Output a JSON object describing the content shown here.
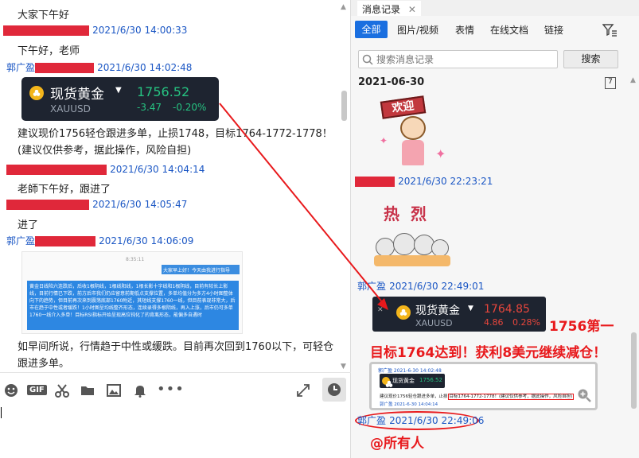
{
  "chat": {
    "messages": [
      {
        "text": "大家下午好"
      },
      {
        "time": "2021/6/30 14:00:33",
        "text": "下午好，老师"
      },
      {
        "sender": "郭广盈",
        "time": "2021/6/30 14:02:48"
      },
      {
        "text": "建议现价1756轻仓跟进多单，止损1748，目标1764-1772-1778！(建议仅供参考，据此操作，风险自担)"
      },
      {
        "time": "2021/6/30 14:04:14",
        "text": "老師下午好，跟进了"
      },
      {
        "time": "2021/6/30 14:05:47",
        "text": "进了"
      },
      {
        "sender": "郭广盈",
        "time": "2021/6/30 14:06:09"
      },
      {
        "text": "如早间所说，行情趋于中性或缓跌。目前再次回到1760以下，可轻仓跟进多单。"
      }
    ],
    "gold_card": {
      "title": "现货黄金",
      "symbol": "XAUUSD",
      "price": "1756.52",
      "change": "-3.47",
      "change_pct": "-0.20%"
    },
    "screenshot_msg": {
      "bubble": "大家早上好！今天由我进行指导",
      "time": "8:35:11",
      "body": "黄金日线险六连跌后，后收1根阴线，1根线阳线，1根长影十字线和1根阴线，目前有较长上影线，目前行情已下跌，前方后市我们仍应留意前期低点支撑位置，多单均值分为多方4小时图整体向下的趋势，但目前再次来到震荡底部1760附近，其短线支撑1760一线，但目前表现非常大，后市在趋于中性或者缓跌！1小时图呈均线整齐形态，连续录得多根阴线，再入上涨，后市仍可多单1760一线介入多单！目标RSI指标开始呈现高位钝化了的背离形态，能偏多自遇时"
    }
  },
  "toolbar": {
    "icons": [
      "emoji-icon",
      "gif-icon",
      "scissors-icon",
      "folder-icon",
      "image-icon",
      "bell-icon",
      "more-icon",
      "expand-icon",
      "history-icon"
    ],
    "gif_label": "GIF"
  },
  "history": {
    "title": "消息记录",
    "close": "✕",
    "tabs": [
      "全部",
      "图片/视频",
      "表情",
      "在线文档",
      "链接"
    ],
    "active_tab": "全部",
    "search_placeholder": "搜索消息记录",
    "search_button": "搜索",
    "date": "2021-06-30",
    "calendar_icon": "7",
    "entries": [
      {
        "time": "2021/6/30 22:23:21",
        "sticker": "欢迎"
      },
      {
        "sender": "郭广盈",
        "time": "2021/6/30 22:49:01",
        "sticker": "热烈"
      },
      {
        "sender": "郭广盈",
        "time": "2021/6/30 22:49:06"
      }
    ],
    "gold_card2": {
      "title": "现货黄金",
      "symbol": "XAUUSD",
      "price": "1764.85",
      "change": "4.86",
      "change_pct": "0.28%"
    },
    "thumb": {
      "sender_line": "郭广盈 2021-6-30 14:02:48",
      "title": "现货黄金",
      "price": "1756.52",
      "text1": "建议现价1756轻仓跟进多单，止损",
      "text2": "目标1764-1772-1778！(建议仅供参考，据此操作，风险自担)",
      "foot": "郭广盈 2021-6-30 14:04:14"
    },
    "annotations": {
      "line1": "1756第一",
      "line2": "目标1764达到！获利8美元继续减仓！",
      "mention": "@所有人"
    }
  },
  "colors": {
    "accent": "#1a6fe0",
    "annotation_red": "#e8191c",
    "name_blue": "#1a56c4"
  }
}
